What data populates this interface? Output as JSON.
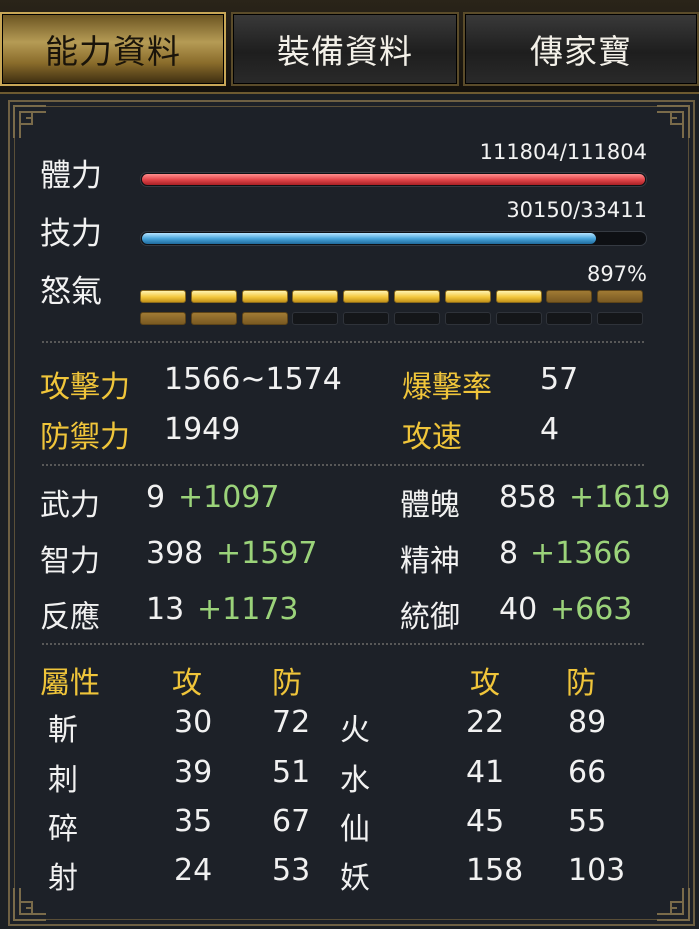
{
  "tabs": [
    {
      "label": "能力資料",
      "active": true
    },
    {
      "label": "裝備資料",
      "active": false
    },
    {
      "label": "傳家寶",
      "active": false
    }
  ],
  "vitals": {
    "hp": {
      "label": "體力",
      "value_text": "111804/111804",
      "fraction": 1.0
    },
    "mp": {
      "label": "技力",
      "value_text": "30150/33411",
      "fraction": 0.9024
    },
    "rage": {
      "label": "怒氣",
      "value_text": "897%",
      "row1": {
        "full": 8,
        "dim": 2
      },
      "row2": {
        "dim": 3,
        "empty": 7
      }
    }
  },
  "combat": {
    "attack": {
      "label": "攻擊力",
      "value": "1566~1574"
    },
    "crit": {
      "label": "爆擊率",
      "value": "57"
    },
    "defense": {
      "label": "防禦力",
      "value": "1949"
    },
    "speed": {
      "label": "攻速",
      "value": "4"
    }
  },
  "attributes": [
    {
      "label": "武力",
      "base": "9",
      "bonus": "+1097"
    },
    {
      "label": "體魄",
      "base": "858",
      "bonus": "+1619"
    },
    {
      "label": "智力",
      "base": "398",
      "bonus": "+1597"
    },
    {
      "label": "精神",
      "base": "8",
      "bonus": "+1366"
    },
    {
      "label": "反應",
      "base": "13",
      "bonus": "+1173"
    },
    {
      "label": "統御",
      "base": "40",
      "bonus": "+663"
    }
  ],
  "elements": {
    "header": {
      "title": "屬性",
      "atk": "攻",
      "def": "防",
      "atk2": "攻",
      "def2": "防"
    },
    "rows": [
      {
        "left": "斬",
        "latk": "30",
        "ldef": "72",
        "right": "火",
        "ratk": "22",
        "rdef": "89"
      },
      {
        "left": "刺",
        "latk": "39",
        "ldef": "51",
        "right": "水",
        "ratk": "41",
        "rdef": "66"
      },
      {
        "left": "碎",
        "latk": "35",
        "ldef": "67",
        "right": "仙",
        "ratk": "45",
        "rdef": "55"
      },
      {
        "left": "射",
        "latk": "24",
        "ldef": "53",
        "right": "妖",
        "ratk": "158",
        "rdef": "103"
      }
    ]
  },
  "colors": {
    "hp": "#e4484c",
    "mp": "#4aa6dc",
    "gold": "#f0c53a",
    "bonus": "#9bd37a"
  }
}
